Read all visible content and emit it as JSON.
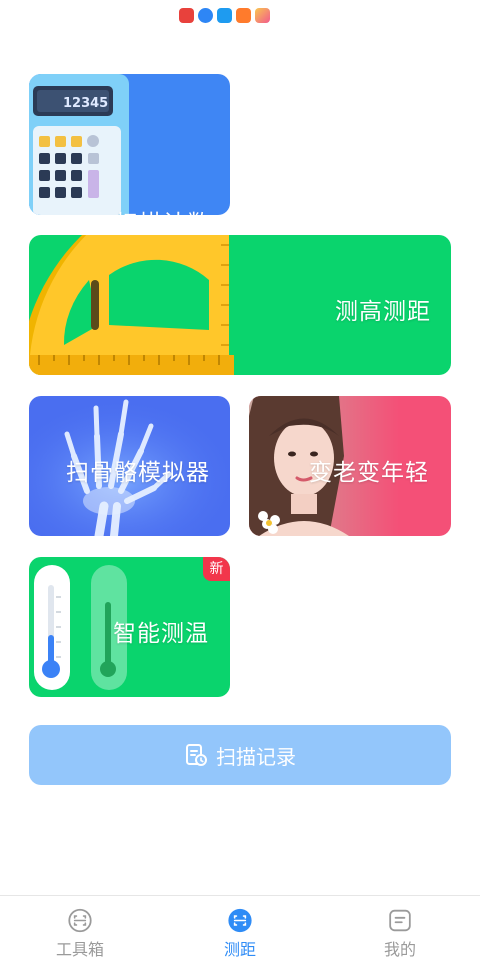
{
  "status_bar": {
    "icons": [
      {
        "name": "huawei-video-icon",
        "color": "#e8413c"
      },
      {
        "name": "browser-icon",
        "color": "#2e86f5"
      },
      {
        "name": "search-app-icon",
        "color": "#1e9bf0"
      },
      {
        "name": "play-app-icon",
        "color": "#ff7b2c"
      },
      {
        "name": "store-app-icon",
        "color": "#f25a8c"
      }
    ]
  },
  "cards": {
    "scan_count": {
      "label": "扫描计数",
      "color": "#3f86f4",
      "display": "12345"
    },
    "measure": {
      "label": "测高测距",
      "color": "#0ad46d"
    },
    "bone": {
      "label": "扫骨骼模拟器",
      "color": "#4a6ef0"
    },
    "age": {
      "label": "变老变年轻",
      "color": "#f45077"
    },
    "temperature": {
      "label": "智能测温",
      "color": "#0ad46d",
      "badge": "新"
    }
  },
  "records_button": {
    "label": "扫描记录",
    "color": "#93c6fb"
  },
  "bottom_nav": {
    "items": [
      {
        "label": "工具箱",
        "icon": "scan-frame-icon",
        "active": false
      },
      {
        "label": "测距",
        "icon": "scan-frame-icon",
        "active": true
      },
      {
        "label": "我的",
        "icon": "profile-card-icon",
        "active": false
      }
    ],
    "active_color": "#2f8cf6",
    "inactive_color": "#9a9a9a"
  }
}
